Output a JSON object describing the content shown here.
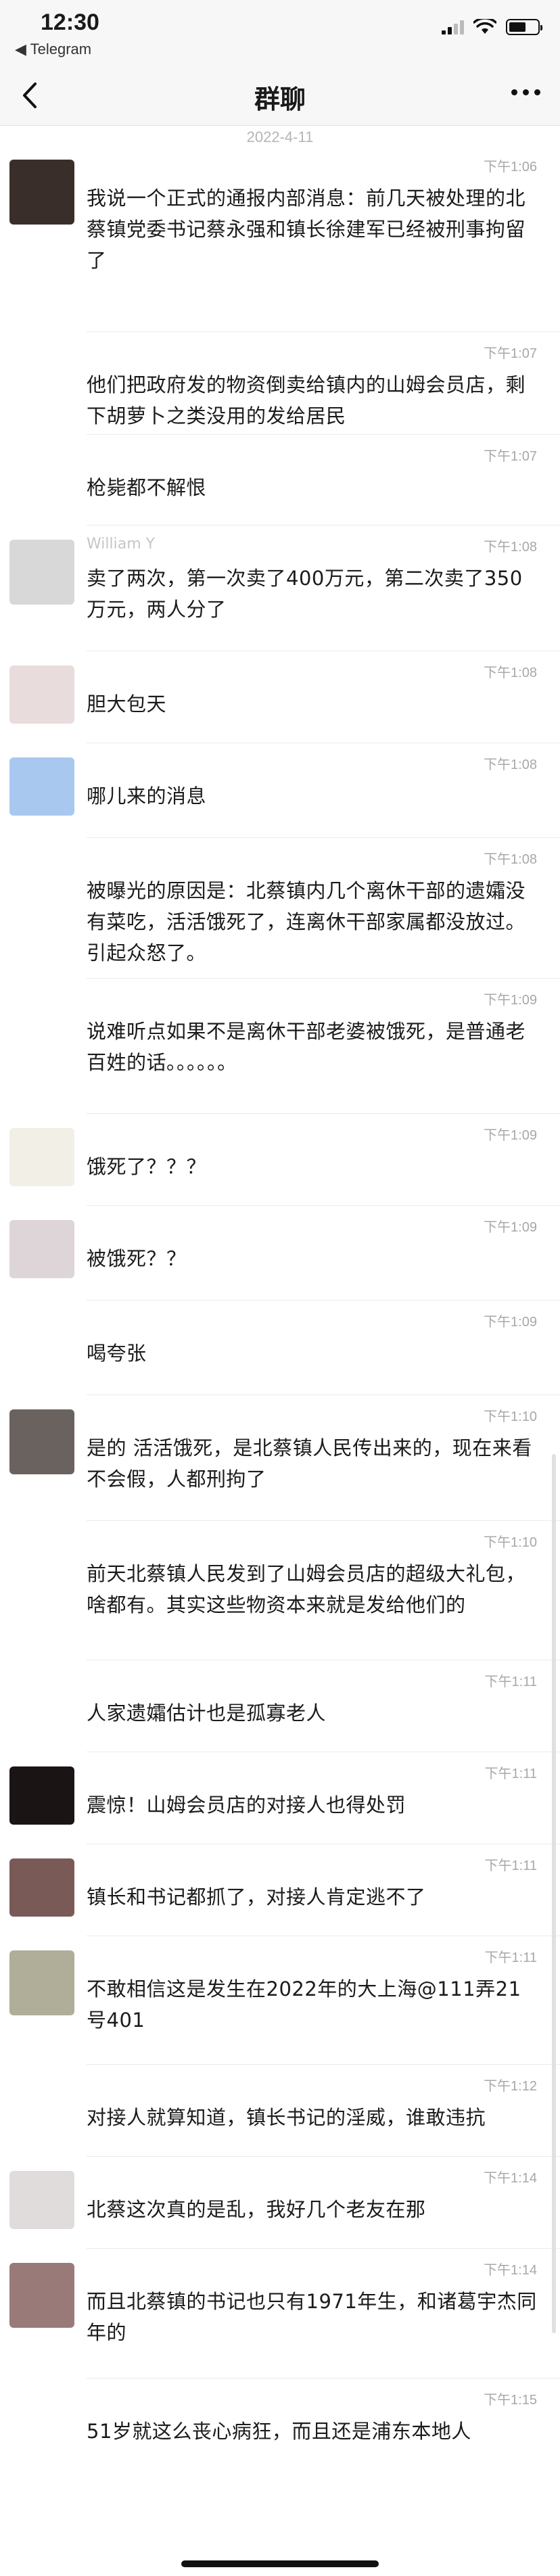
{
  "status_bar": {
    "time": "12:30",
    "back_app": "◀ Telegram",
    "signal_icon": "cellular-signal-icon",
    "wifi_icon": "wifi-icon",
    "battery_icon": "battery-icon"
  },
  "nav": {
    "title": "群聊",
    "back_icon": "chevron-left-icon",
    "more_icon": "more-dots-icon"
  },
  "date_separator": "2022-4-11",
  "messages": [
    {
      "sender": "",
      "time": "下午1:06",
      "text": "我说一个正式的通报内部消息：前几天被处理的北蔡镇党委书记蔡永强和镇长徐建军已经被刑事拘留了",
      "avatar_color": "#3a2e2a"
    },
    {
      "sender": "",
      "time": "下午1:07",
      "text": "他们把政府发的物资倒卖给镇内的山姆会员店，剩下胡萝卜之类没用的发给居民",
      "avatar_color": "#ffffff"
    },
    {
      "sender": "",
      "time": "下午1:07",
      "text": "枪毙都不解恨",
      "avatar_color": "#ffffff"
    },
    {
      "sender": "William Y",
      "time": "下午1:08",
      "text": "卖了两次，第一次卖了400万元，第二次卖了350万元，两人分了",
      "avatar_color": "#d8d8d8"
    },
    {
      "sender": "",
      "time": "下午1:08",
      "text": "胆大包天",
      "avatar_color": "#e8dcdc"
    },
    {
      "sender": "",
      "time": "下午1:08",
      "text": "哪儿来的消息",
      "avatar_color": "#a9c8f0"
    },
    {
      "sender": "",
      "time": "下午1:08",
      "text": "被曝光的原因是：北蔡镇内几个离休干部的遗孀没有菜吃，活活饿死了，连离休干部家属都没放过。引起众怒了。",
      "avatar_color": "#ffffff"
    },
    {
      "sender": "",
      "time": "下午1:09",
      "text": "说难听点如果不是离休干部老婆被饿死，是普通老百姓的话。。。。。。",
      "avatar_color": "#ffffff"
    },
    {
      "sender": "",
      "time": "下午1:09",
      "text": "饿死了？？？",
      "avatar_color": "#f2efe6"
    },
    {
      "sender": "",
      "time": "下午1:09",
      "text": "被饿死？？",
      "avatar_color": "#ddd5d8"
    },
    {
      "sender": "",
      "time": "下午1:09",
      "text": "喝夸张",
      "avatar_color": "#ffffff"
    },
    {
      "sender": "",
      "time": "下午1:10",
      "text": "是的 活活饿死，是北蔡镇人民传出来的，现在来看不会假，人都刑拘了",
      "avatar_color": "#6a625e"
    },
    {
      "sender": "",
      "time": "下午1:10",
      "text": "前天北蔡镇人民发到了山姆会员店的超级大礼包，啥都有。其实这些物资本来就是发给他们的",
      "avatar_color": "#ffffff"
    },
    {
      "sender": "",
      "time": "下午1:11",
      "text": "人家遗孀估计也是孤寡老人",
      "avatar_color": "#ffffff"
    },
    {
      "sender": "",
      "time": "下午1:11",
      "text": "震惊！山姆会员店的对接人也得处罚",
      "avatar_color": "#1a1414"
    },
    {
      "sender": "",
      "time": "下午1:11",
      "text": "镇长和书记都抓了，对接人肯定逃不了",
      "avatar_color": "#7a5a56"
    },
    {
      "sender": "",
      "time": "下午1:11",
      "text": "不敢相信这是发生在2022年的大上海@111弄21号401",
      "avatar_color": "#b0ad98"
    },
    {
      "sender": "",
      "time": "下午1:12",
      "text": "对接人就算知道，镇长书记的淫威，谁敢违抗",
      "avatar_color": "#ffffff"
    },
    {
      "sender": "",
      "time": "下午1:14",
      "text": "北蔡这次真的是乱，我好几个老友在那",
      "avatar_color": "#e0dcdc"
    },
    {
      "sender": "",
      "time": "下午1:14",
      "text": "而且北蔡镇的书记也只有1971年生，和诸葛宇杰同年的",
      "avatar_color": "#9a7a78"
    },
    {
      "sender": "",
      "time": "下午1:15",
      "text": "51岁就这么丧心病狂，而且还是浦东本地人",
      "avatar_color": "#ffffff"
    }
  ]
}
